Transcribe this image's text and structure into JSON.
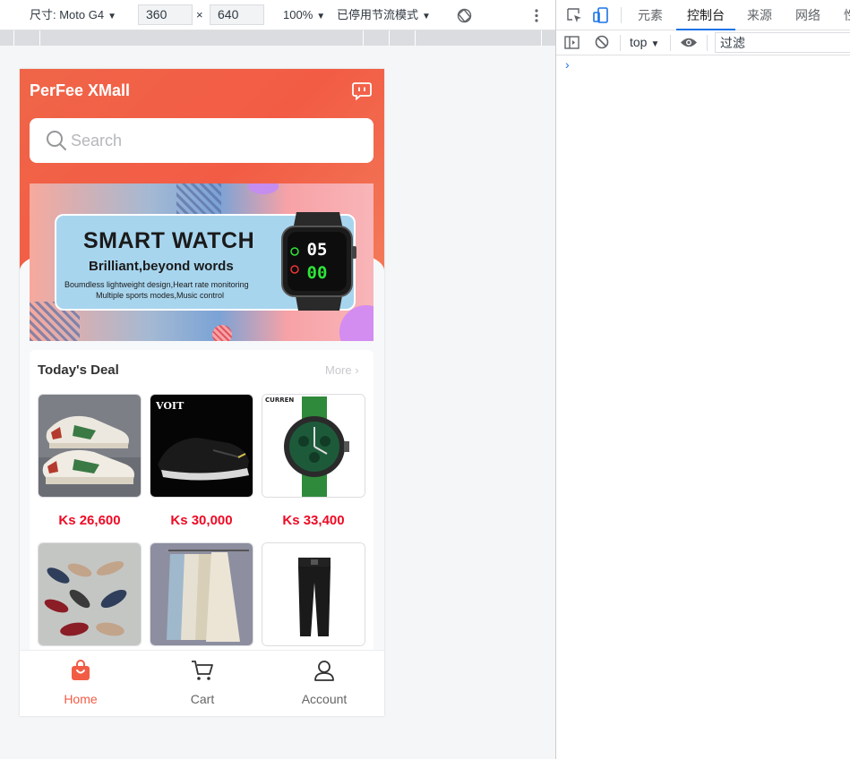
{
  "device_toolbar": {
    "dimensions_label": "尺寸: Moto G4",
    "width_value": "360",
    "times_symbol": "×",
    "height_value": "640",
    "zoom": "100%",
    "throttling": "已停用节流模式"
  },
  "devtools": {
    "tabs": [
      {
        "label": "元素",
        "active": false
      },
      {
        "label": "控制台",
        "active": true
      },
      {
        "label": "来源",
        "active": false
      },
      {
        "label": "网络",
        "active": false
      },
      {
        "label": "性",
        "active": false
      }
    ],
    "context": "top",
    "filter_placeholder": "过滤",
    "prompt": "›"
  },
  "app": {
    "title": "PerFee XMall",
    "search_placeholder": "Search",
    "banner": {
      "title": "SMART WATCH",
      "subtitle": "Brilliant,beyond words",
      "line1": "Boumdless lightweight design,Heart rate monitoring",
      "line2": "Multiple sports modes,Music control",
      "watch_time_top": "05",
      "watch_time_bottom": "00"
    },
    "deals": {
      "title": "Today's Deal",
      "more": "More",
      "products": [
        {
          "image": "sneaker-green-stripe",
          "price": "Ks 26,600"
        },
        {
          "image": "black-slip-on-shoe",
          "brand": "VOIT",
          "price": "Ks 30,000"
        },
        {
          "image": "green-strap-watch",
          "brand": "CURREN",
          "price": "Ks 33,400"
        },
        {
          "image": "ballet-flats",
          "price": ""
        },
        {
          "image": "long-dresses-on-rack",
          "price": ""
        },
        {
          "image": "black-trousers",
          "price": ""
        }
      ]
    },
    "bottom_nav": [
      {
        "label": "Home",
        "icon": "shopping-bag-icon",
        "active": true
      },
      {
        "label": "Cart",
        "icon": "cart-icon",
        "active": false
      },
      {
        "label": "Account",
        "icon": "user-icon",
        "active": false
      }
    ],
    "colors": {
      "brand": "#f25c45",
      "price": "#ee0a24",
      "active_nav": "#f25c45"
    }
  }
}
